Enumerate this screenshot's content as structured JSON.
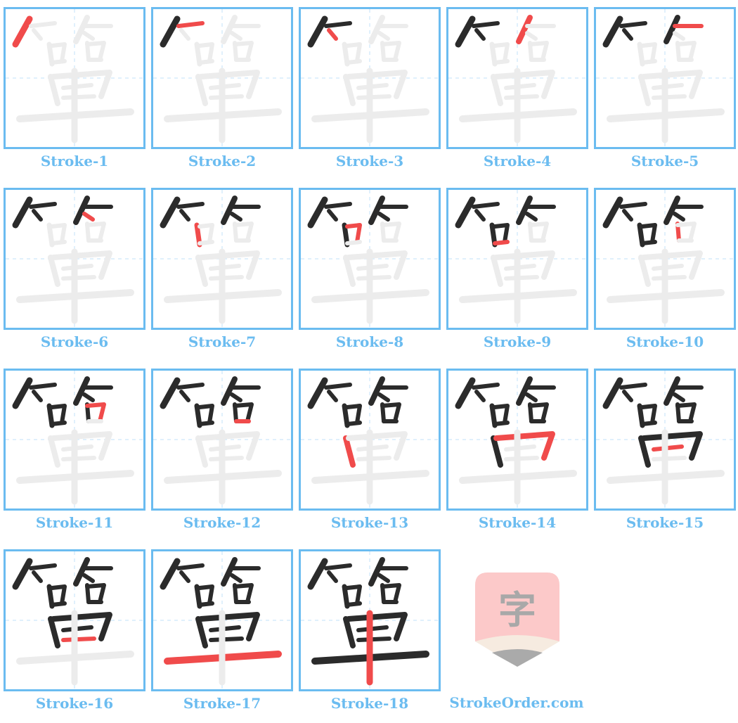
{
  "character": "箪",
  "stroke_count": 18,
  "colors": {
    "border": "#6bbcf0",
    "current_stroke": "#f04b4b",
    "done_stroke": "#2b2b2b",
    "ghost": "#ececec",
    "guide": "#d6ecfb",
    "label": "#6bbcf0"
  },
  "cells": [
    {
      "label": "Stroke-1",
      "stroke": 1
    },
    {
      "label": "Stroke-2",
      "stroke": 2
    },
    {
      "label": "Stroke-3",
      "stroke": 3
    },
    {
      "label": "Stroke-4",
      "stroke": 4
    },
    {
      "label": "Stroke-5",
      "stroke": 5
    },
    {
      "label": "Stroke-6",
      "stroke": 6
    },
    {
      "label": "Stroke-7",
      "stroke": 7
    },
    {
      "label": "Stroke-8",
      "stroke": 8
    },
    {
      "label": "Stroke-9",
      "stroke": 9
    },
    {
      "label": "Stroke-10",
      "stroke": 10
    },
    {
      "label": "Stroke-11",
      "stroke": 11
    },
    {
      "label": "Stroke-12",
      "stroke": 12
    },
    {
      "label": "Stroke-13",
      "stroke": 13
    },
    {
      "label": "Stroke-14",
      "stroke": 14
    },
    {
      "label": "Stroke-15",
      "stroke": 15
    },
    {
      "label": "Stroke-16",
      "stroke": 16
    },
    {
      "label": "Stroke-17",
      "stroke": 17
    },
    {
      "label": "Stroke-18",
      "stroke": 18
    }
  ],
  "logo": {
    "glyph": "字",
    "site": "StrokeOrder.com"
  }
}
